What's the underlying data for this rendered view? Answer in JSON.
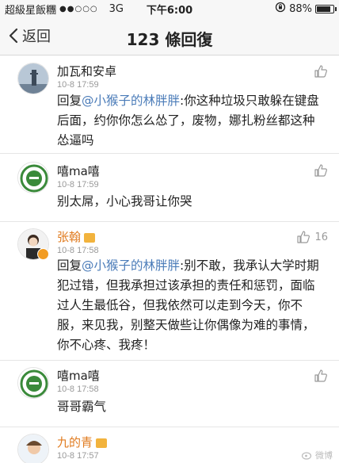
{
  "status": {
    "carrier": "超級星飯糰",
    "signal_dots": "●●○○○",
    "network": "3G",
    "time": "下午6:00",
    "battery": "88%",
    "battery_level": 0.88
  },
  "nav": {
    "back_label": "返回",
    "title": "123 條回復"
  },
  "comments": [
    {
      "user": "加瓦和安卓",
      "time": "10-8 17:59",
      "prefix": "回复",
      "mention": "@小猴子的林胖胖",
      "text": ":你这种垃圾只敢躲在键盘后面，约你你怎么怂了，废物，娜扎粉丝都这种怂逼吗"
    },
    {
      "user": "嘻ma嘻",
      "time": "10-8 17:59",
      "text": "别太屌，小心我哥让你哭"
    },
    {
      "user": "张翰",
      "time": "10-8 17:58",
      "likes": "16",
      "prefix": "回复",
      "mention": "@小猴子的林胖胖",
      "text": ":别不敢，我承认大学时期犯过错，但我承担过该承担的责任和惩罚，面临过人生最低谷，但我依然可以走到今天，你不服，来见我，别整天做些让你偶像为难的事情，你不心疼、我疼！"
    },
    {
      "user": "嘻ma嘻",
      "time": "10-8 17:58",
      "text": "哥哥霸气"
    },
    {
      "user": "九的青",
      "time": "10-8 17:57"
    }
  ],
  "watermark": "微博"
}
